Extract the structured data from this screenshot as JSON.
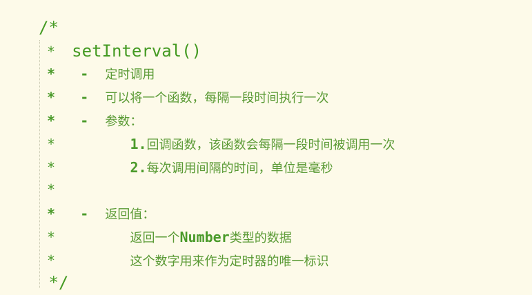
{
  "code_lines": [
    {
      "prefix": "/*",
      "text": ""
    },
    {
      "prefix": " *  ",
      "text": "setInterval()"
    },
    {
      "prefix": " *   -  ",
      "text": "定时调用"
    },
    {
      "prefix": " *   -  ",
      "text": "可以将一个函数，每隔一段时间执行一次"
    },
    {
      "prefix": " *   -  ",
      "text": "参数："
    },
    {
      "prefix": " *         ",
      "num": "1.",
      "text": "回调函数，该函数会每隔一段时间被调用一次"
    },
    {
      "prefix": " *         ",
      "num": "2.",
      "text": "每次调用间隔的时间，单位是毫秒"
    },
    {
      "prefix": " *",
      "text": ""
    },
    {
      "prefix": " *   -  ",
      "text": "返回值："
    },
    {
      "prefix": " *         ",
      "text": "返回一个",
      "kw": "Number",
      "suffix": "类型的数据"
    },
    {
      "prefix": " *         ",
      "text": "这个数字用来作为定时器的唯一标识"
    },
    {
      "prefix": " */",
      "text": ""
    }
  ]
}
